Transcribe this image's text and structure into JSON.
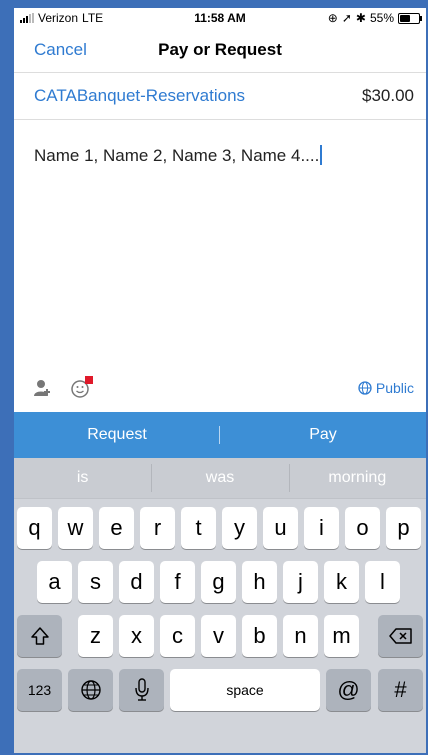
{
  "status_bar": {
    "carrier": "Verizon",
    "network": "LTE",
    "time": "11:58 AM",
    "battery_text": "55%",
    "battery_level": 0.55
  },
  "nav": {
    "cancel_label": "Cancel",
    "title": "Pay or Request"
  },
  "recipient": {
    "name": "CATABanquet-Reservations",
    "amount": "$30.00"
  },
  "note": {
    "text": "Name 1, Name 2, Name 3, Name 4...."
  },
  "note_tools": {
    "person_icon": "add-person-icon",
    "emoji_icon": "emoji-icon",
    "privacy_label": "Public"
  },
  "actions": {
    "request_label": "Request",
    "pay_label": "Pay"
  },
  "keyboard": {
    "suggestions": [
      "is",
      "was",
      "morning"
    ],
    "row1": [
      "q",
      "w",
      "e",
      "r",
      "t",
      "y",
      "u",
      "i",
      "o",
      "p"
    ],
    "row2": [
      "a",
      "s",
      "d",
      "f",
      "g",
      "h",
      "j",
      "k",
      "l"
    ],
    "row3": [
      "z",
      "x",
      "c",
      "v",
      "b",
      "n",
      "m"
    ],
    "numbers_label": "123",
    "space_label": "space",
    "at_label": "@",
    "hash_label": "#"
  },
  "colors": {
    "accent": "#2f7bd1",
    "action_bar": "#3d8fd6",
    "frame": "#3d6fb8",
    "keyboard_bg": "#d1d4da"
  }
}
